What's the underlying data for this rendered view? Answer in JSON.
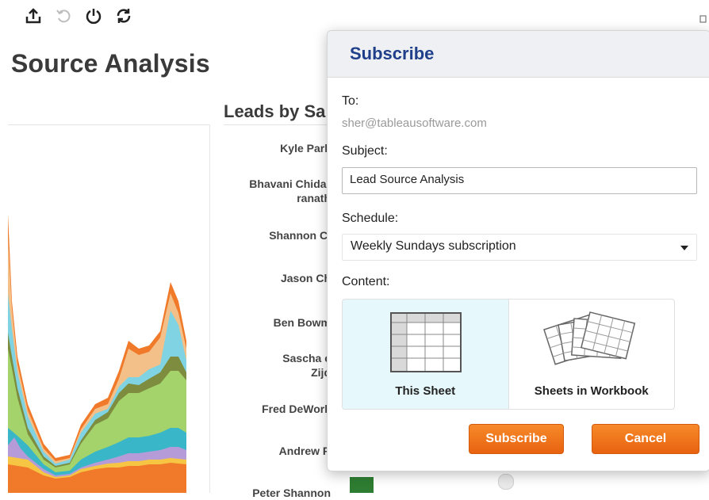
{
  "toolbar": {
    "icons": [
      "share-icon",
      "revert-icon",
      "power-icon",
      "refresh-icon"
    ]
  },
  "page_title": "Source Analysis",
  "chart2": {
    "title": "Leads by Sa",
    "names": [
      "Kyle Park",
      "Bhavani Chidar\nranath",
      "Shannon Cl",
      "Jason Ch",
      "Ben Bowm",
      "Sascha c\nZijd",
      "Fred DeWork",
      "Andrew R",
      "Peter Shannon"
    ]
  },
  "colors": {
    "orange": "#f07a2a",
    "light_orange": "#f4c08a",
    "teal": "#7fd3e2",
    "olive": "#7d8c3e",
    "green": "#a3d36a",
    "cyan": "#39b7c8",
    "purple": "#b59cd9",
    "gold": "#f6c544",
    "dark_green": "#2e7d32",
    "dialog_title": "#1f3f8a",
    "button": "#f07a2a"
  },
  "dialog": {
    "title": "Subscribe",
    "to_label": "To:",
    "to_value": "sher@tableausoftware.com",
    "subject_label": "Subject:",
    "subject_value": "Lead Source Analysis",
    "schedule_label": "Schedule:",
    "schedule_value": "Weekly Sundays subscription",
    "content_label": "Content:",
    "options": [
      {
        "label": "This Sheet",
        "selected": true
      },
      {
        "label": "Sheets in Workbook",
        "selected": false
      }
    ],
    "subscribe_label": "Subscribe",
    "cancel_label": "Cancel"
  }
}
